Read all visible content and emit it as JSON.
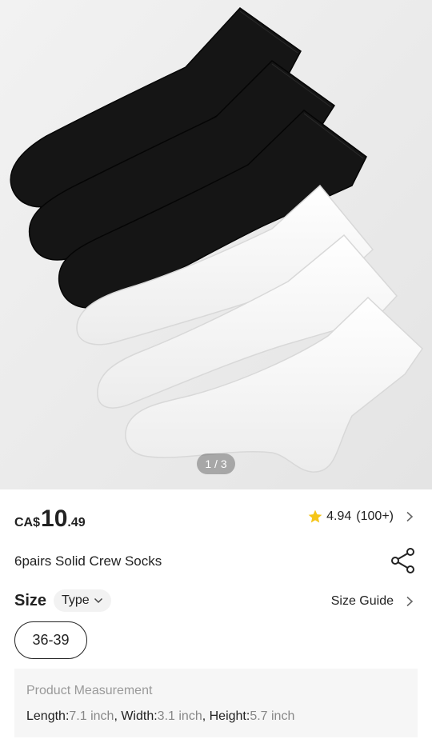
{
  "gallery": {
    "pager_text": "1 / 3"
  },
  "price": {
    "currency": "CA$",
    "integer": "10",
    "decimal": ".49"
  },
  "rating": {
    "score": "4.94",
    "count": "(100+)"
  },
  "product": {
    "title": "6pairs Solid Crew Socks"
  },
  "size": {
    "label": "Size",
    "type_label": "Type",
    "guide_label": "Size Guide",
    "options": [
      "36-39"
    ],
    "selected": "36-39"
  },
  "measurement": {
    "title": "Product Measurement",
    "length_label": "Length:",
    "length_value": "7.1 inch",
    "width_label": "Width:",
    "width_value": "3.1 inch",
    "height_label": "Height:",
    "height_value": "5.7 inch"
  },
  "colors": {
    "star": "#f5c518",
    "sock_black": "#141414",
    "sock_white": "#fafafa"
  }
}
